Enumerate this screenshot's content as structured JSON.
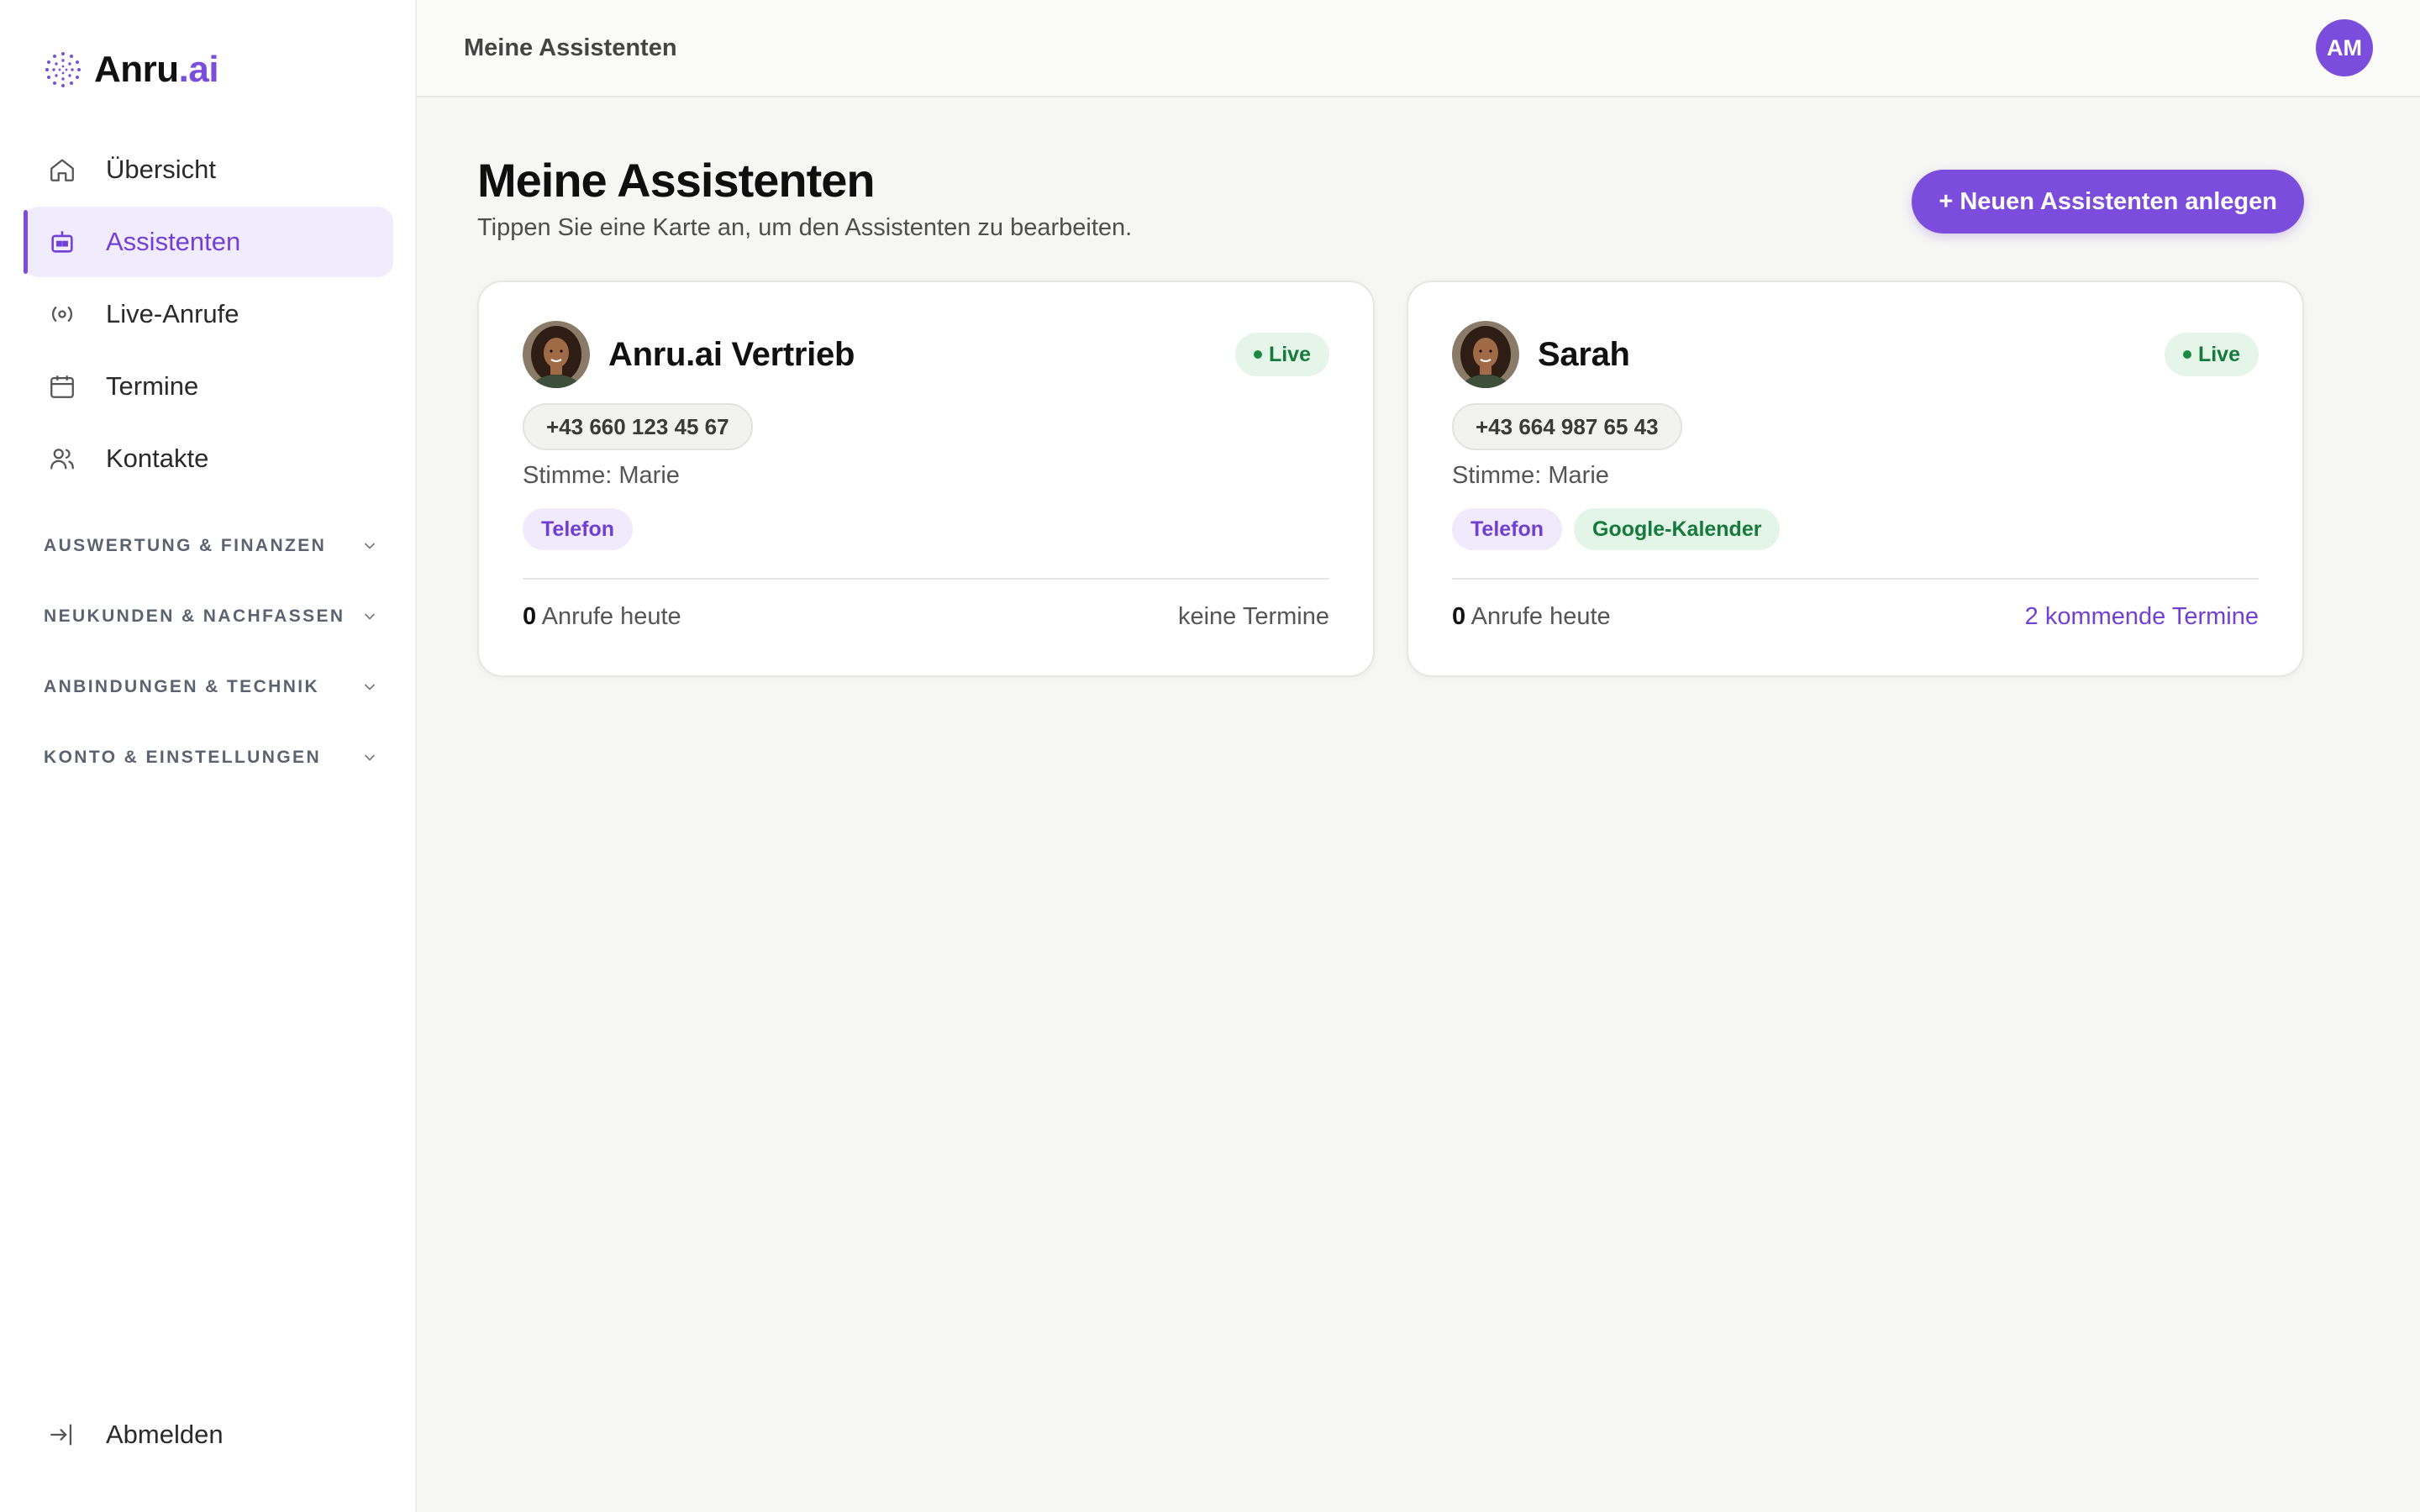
{
  "brand": {
    "name_main": "Anru",
    "name_accent": ".ai"
  },
  "sidebar": {
    "items": [
      {
        "label": "Übersicht",
        "icon": "home-icon"
      },
      {
        "label": "Assistenten",
        "icon": "robot-icon",
        "active": true
      },
      {
        "label": "Live-Anrufe",
        "icon": "broadcast-icon"
      },
      {
        "label": "Termine",
        "icon": "calendar-icon"
      },
      {
        "label": "Kontakte",
        "icon": "users-icon"
      }
    ],
    "sections": [
      {
        "label": "AUSWERTUNG & FINANZEN"
      },
      {
        "label": "NEUKUNDEN & NACHFASSEN"
      },
      {
        "label": "ANBINDUNGEN & TECHNIK"
      },
      {
        "label": "KONTO & EINSTELLUNGEN"
      }
    ],
    "logout_label": "Abmelden"
  },
  "topbar": {
    "title": "Meine Assistenten",
    "avatar_initials": "AM"
  },
  "page": {
    "title": "Meine Assistenten",
    "subtitle": "Tippen Sie eine Karte an, um den Assistenten zu bearbeiten.",
    "new_button": "+ Neuen Assistenten anlegen"
  },
  "assistants": [
    {
      "name": "Anru.ai Vertrieb",
      "status": "Live",
      "phone": "+43 660 123 45 67",
      "voice": "Stimme: Marie",
      "tags": [
        "Telefon"
      ],
      "calls_count": "0",
      "calls_label": "Anrufe heute",
      "appointments": "keine Termine"
    },
    {
      "name": "Sarah",
      "status": "Live",
      "phone": "+43 664 987 65 43",
      "voice": "Stimme: Marie",
      "tags": [
        "Telefon",
        "Google-Kalender"
      ],
      "calls_count": "0",
      "calls_label": "Anrufe heute",
      "appointments": "2 kommende Termine"
    }
  ],
  "colors": {
    "accent": "#7c4ddc",
    "live_green": "#167a3a",
    "background": "#f6f6f4"
  }
}
